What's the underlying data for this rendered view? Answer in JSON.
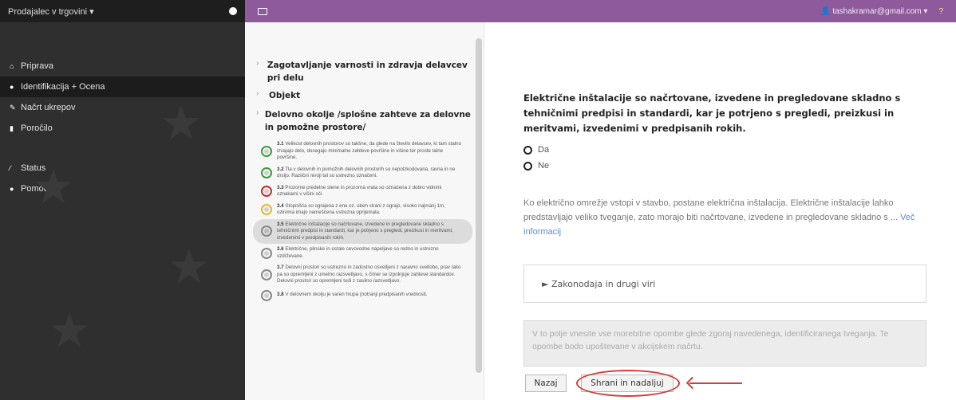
{
  "sidebar": {
    "title": "Prodajalec v trgovini",
    "items": [
      {
        "label": "Priprava",
        "icon": "home-icon",
        "active": false
      },
      {
        "label": "Identifikacija + Ocena",
        "icon": "check-circle-icon",
        "active": true
      },
      {
        "label": "Načrt ukrepov",
        "icon": "pencil-icon",
        "active": false
      },
      {
        "label": "Poročilo",
        "icon": "document-icon",
        "active": false
      }
    ],
    "items2": [
      {
        "label": "Status",
        "icon": "chart-icon"
      },
      {
        "label": "Pomoč",
        "icon": "help-icon"
      }
    ]
  },
  "topbar": {
    "user": "tashakramar@gmail.com",
    "help": "?"
  },
  "qpanel": {
    "sections": [
      "Zagotavljanje varnosti in zdravja delavcev pri delu",
      "Objekt",
      "Delovno okolje /splošne zahteve za delovne in pomožne prostore/"
    ],
    "items": [
      {
        "num": "3.1",
        "status": "green",
        "text": "Velikost delovnih prostorov so takšne, da glede na število delavcev, ki tam stalno izvajajo delo, dosegajo minimalne zahteve površine in višine ter proste talne površine."
      },
      {
        "num": "3.2",
        "status": "green",
        "text": "Tla v delovnih in pomožnih delovnih prostorih so nepolzkodovana, ravna in ne drsijo. Različni nivoji tal so ustrezno označeni."
      },
      {
        "num": "3.3",
        "status": "red",
        "text": "Prozorne predelne stene in prozorna vrata so označena z dobro vidnimi oznakami v višini oči."
      },
      {
        "num": "3.4",
        "status": "yellow",
        "text": "Stopnišča so ograjena z ene oz. obeh strani z ograjo, visoko najmanj 1m, oziroma imajo nameščena ustrezna oprijemala."
      },
      {
        "num": "3.5",
        "status": "grey",
        "active": true,
        "text": "Električne inštalacije so načrtovane, izvedene in pregledovane skladno s tehničnimi predpisi in standardi, kar je potrjeno s pregledi, preizkusi in meritvami, izvedenimi v predpisanih rokih."
      },
      {
        "num": "3.6",
        "status": "grey",
        "text": "Električne, plinske in ostale cevovodne napeljave so redno in ustrezno vzdrževane."
      },
      {
        "num": "3.7",
        "status": "grey",
        "text": "Delovni prostori so ustrezno in zadostno osvetljeni z naravno svetlobo, prav tako pa so opremljeni z umetno razsvetljavo, s čimer se izpolnjuje zahteve standardov. Delovni prostori so opremljeni tudi z zasilno razsvetljavo."
      },
      {
        "num": "3.8",
        "status": "grey",
        "text": "V delovnem okolju je varen hrupa (notranji predpisanih vrednosti."
      }
    ]
  },
  "main": {
    "question": "Električne inštalacije so načrtovane, izvedene in pregledovane skladno s tehničnimi predpisi in standardi, kar je potrjeno s pregledi, preizkusi in meritvami, izvedenimi v predpisanih rokih.",
    "option_yes": "Da",
    "option_no": "Ne",
    "info": "Ko električno omrežje vstopi v stavbo, postane električna inštalacija. Električne inštalacije lahko predstavljajo veliko tveganje, zato morajo biti načrtovane, izvedene in pregledovane skladno s ...",
    "more": "Več informacij",
    "accordion": "► Zakonodaja in drugi viri",
    "notes_placeholder": "V to polje vnesite vse morebitne opombe glede zgoraj navedenega, identificiranega tveganja. Te opombe bodo upoštevane v akcijskem načrtu.",
    "back_label": "Nazaj",
    "save_label": "Shrani in nadaljuj"
  },
  "colors": {
    "topbar": "#8e5a9c",
    "sidebar": "#2f2f2f",
    "highlight": "#d43b3b"
  }
}
